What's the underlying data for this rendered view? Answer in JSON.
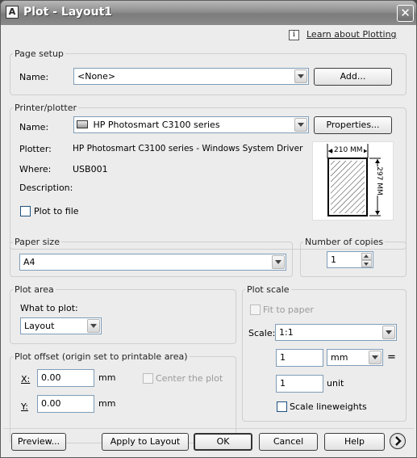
{
  "window": {
    "title": "Plot - Layout1",
    "close_glyph": "✕"
  },
  "help_link": {
    "icon": "info-icon",
    "icon_glyph": "i",
    "text": "Learn about Plotting"
  },
  "page_setup": {
    "legend": "Page setup",
    "name_label": "Name:",
    "name_value": "<None>",
    "add_button": "Add..."
  },
  "printer": {
    "legend": "Printer/plotter",
    "name_label": "Name:",
    "name_value": "HP Photosmart C3100 series",
    "printer_icon": "printer-icon",
    "properties_button": "Properties...",
    "plotter_label": "Plotter:",
    "plotter_value": "HP Photosmart C3100 series - Windows System Driver - ...",
    "where_label": "Where:",
    "where_value": "USB001",
    "description_label": "Description:",
    "plot_to_file_label": "Plot to file",
    "plot_to_file_checked": false,
    "preview_width": "210 MM",
    "preview_height": "297 MM"
  },
  "paper_size": {
    "legend": "Paper size",
    "value": "A4"
  },
  "copies": {
    "legend": "Number of copies",
    "value": "1"
  },
  "plot_area": {
    "legend": "Plot area",
    "what_label": "What to plot:",
    "what_value": "Layout"
  },
  "plot_offset": {
    "legend": "Plot offset (origin set to printable area)",
    "x_label": "X:",
    "x_value": "0.00",
    "x_unit": "mm",
    "y_label": "Y:",
    "y_value": "0.00",
    "y_unit": "mm",
    "center_label": "Center the plot",
    "center_checked": false
  },
  "plot_scale": {
    "legend": "Plot scale",
    "fit_label": "Fit to paper",
    "fit_checked": false,
    "scale_label": "Scale:",
    "scale_value": "1:1",
    "value1": "1",
    "unit1": "mm",
    "equals": "=",
    "value2": "1",
    "unit2": "unit",
    "lineweights_label": "Scale lineweights",
    "lineweights_checked": false
  },
  "footer": {
    "preview_button": "Preview...",
    "apply_button": "Apply to Layout",
    "ok_button": "OK",
    "cancel_button": "Cancel",
    "help_button": "Help",
    "expand_icon": "chevron-right-icon"
  }
}
